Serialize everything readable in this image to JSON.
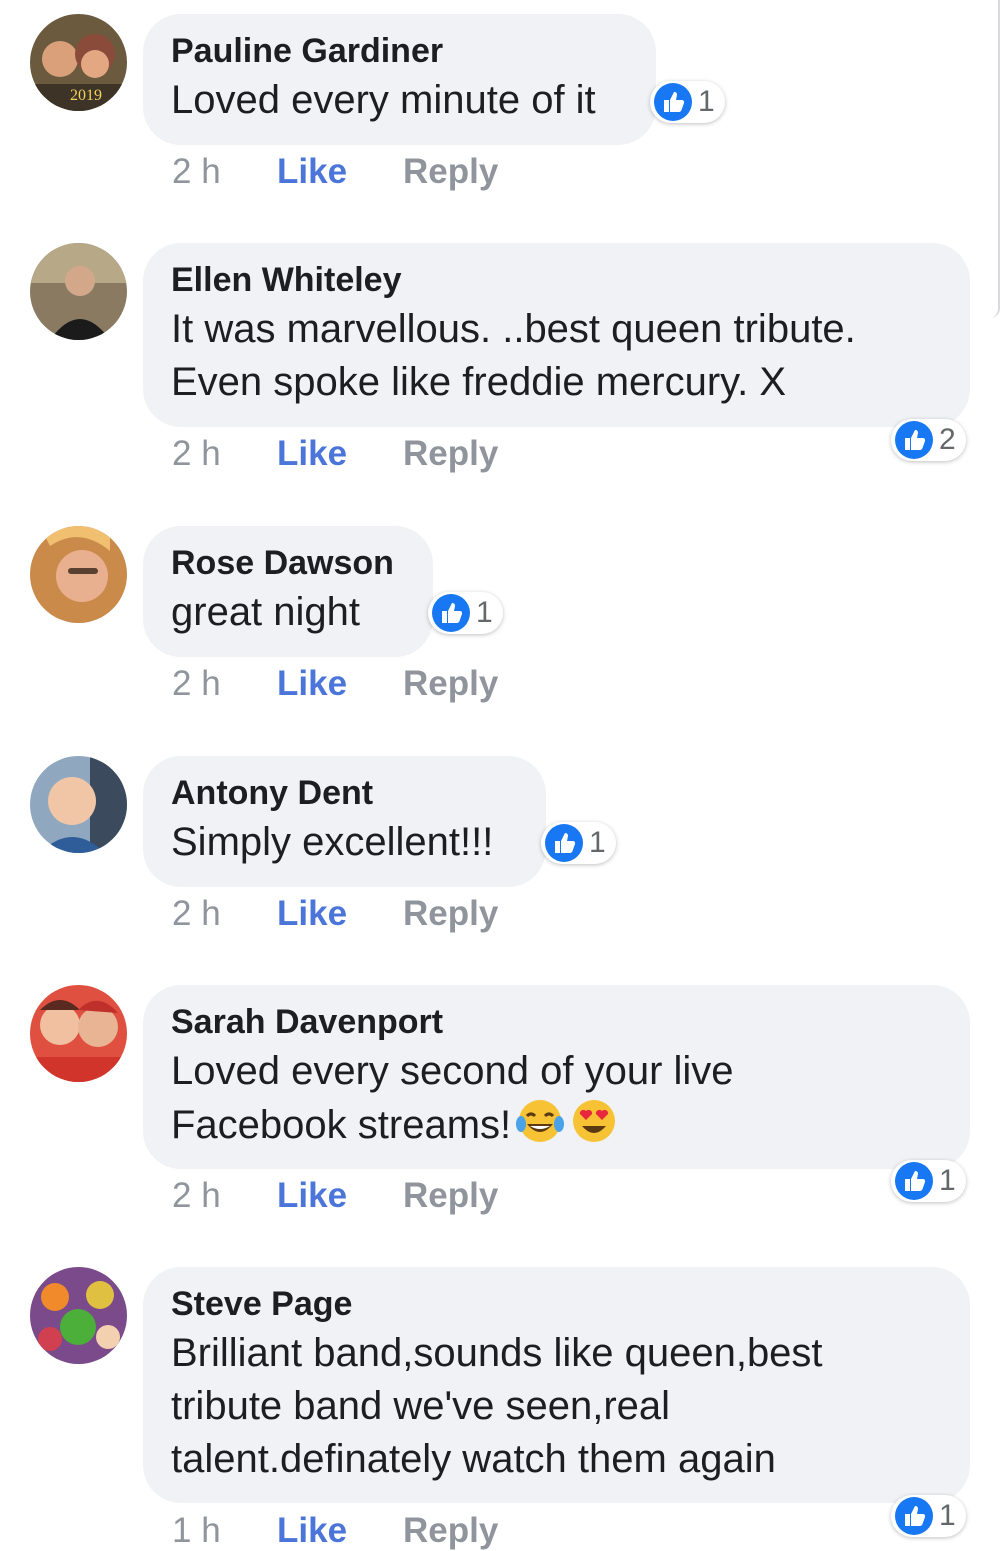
{
  "comments": [
    {
      "author": "Pauline Gardiner",
      "text": "Loved every minute of it",
      "time": "2 h",
      "reactions": "1"
    },
    {
      "author": "Ellen Whiteley",
      "text": "It was marvellous. ..best queen tribute.\nEven spoke like freddie mercury.    X",
      "time": "2 h",
      "reactions": "2"
    },
    {
      "author": "Rose Dawson",
      "text": "great night",
      "time": "2 h",
      "reactions": "1"
    },
    {
      "author": "Antony Dent",
      "text": "Simply excellent!!!",
      "time": "2 h",
      "reactions": "1"
    },
    {
      "author": "Sarah Davenport",
      "text": "Loved every second of your live\nFacebook streams!",
      "time": "2 h",
      "reactions": "1",
      "emojis": [
        "tears-of-joy-emoji",
        "heart-eyes-emoji"
      ]
    },
    {
      "author": "Steve Page",
      "text": "Brilliant band,sounds like queen,best\ntribute band we've seen,real\ntalent.definately watch them again",
      "time": "1 h",
      "reactions": "1"
    }
  ],
  "actions": {
    "like": "Like",
    "reply": "Reply"
  },
  "avatars": {
    "a0": "2019"
  },
  "colors": {
    "like_blue": "#4b75d8",
    "bubble": "#f0f2f5",
    "reaction_blue": "#1877f2",
    "meta_gray": "#90949c"
  },
  "icons": {
    "reaction": "thumbs-up-icon"
  }
}
